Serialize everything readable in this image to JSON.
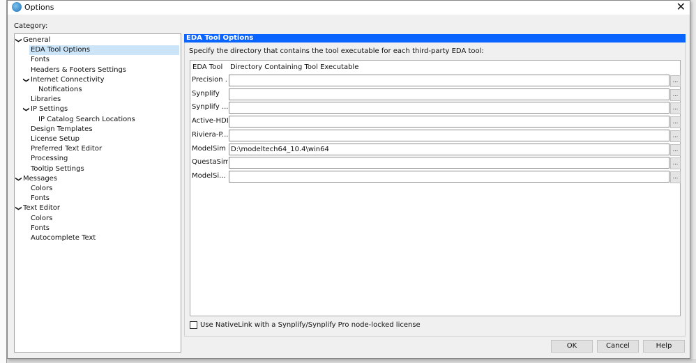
{
  "window": {
    "title": "Options",
    "close": "✕"
  },
  "category_label": "Category:",
  "tree": [
    {
      "label": "General",
      "level": 0,
      "expanded": true
    },
    {
      "label": "EDA Tool Options",
      "level": 1,
      "selected": true
    },
    {
      "label": "Fonts",
      "level": 1
    },
    {
      "label": "Headers & Footers Settings",
      "level": 1
    },
    {
      "label": "Internet Connectivity",
      "level": 1,
      "expanded": true
    },
    {
      "label": "Notifications",
      "level": 2
    },
    {
      "label": "Libraries",
      "level": 1
    },
    {
      "label": "IP Settings",
      "level": 1,
      "expanded": true
    },
    {
      "label": "IP Catalog Search Locations",
      "level": 2
    },
    {
      "label": "Design Templates",
      "level": 1
    },
    {
      "label": "License Setup",
      "level": 1
    },
    {
      "label": "Preferred Text Editor",
      "level": 1
    },
    {
      "label": "Processing",
      "level": 1
    },
    {
      "label": "Tooltip Settings",
      "level": 1
    },
    {
      "label": "Messages",
      "level": 0,
      "expanded": true
    },
    {
      "label": "Colors",
      "level": 1
    },
    {
      "label": "Fonts",
      "level": 1
    },
    {
      "label": "Text Editor",
      "level": 0,
      "expanded": true
    },
    {
      "label": "Colors",
      "level": 1
    },
    {
      "label": "Fonts",
      "level": 1
    },
    {
      "label": "Autocomplete Text",
      "level": 1
    }
  ],
  "panel": {
    "header": "EDA Tool Options",
    "description": "Specify the directory that contains the tool executable for each third-party EDA tool:",
    "columns": [
      "EDA Tool",
      "Directory Containing Tool Executable"
    ],
    "rows": [
      {
        "tool": "Precision ...",
        "dir": ""
      },
      {
        "tool": "Synplify",
        "dir": ""
      },
      {
        "tool": "Synplify ...",
        "dir": ""
      },
      {
        "tool": "Active-HDL",
        "dir": ""
      },
      {
        "tool": "Riviera-P...",
        "dir": ""
      },
      {
        "tool": "ModelSim",
        "dir": "D:\\modeltech64_10.4\\win64"
      },
      {
        "tool": "QuestaSim",
        "dir": ""
      },
      {
        "tool": "ModelSi...",
        "dir": ""
      }
    ],
    "browse_label": "...",
    "nativelink_label": "Use NativeLink with a Synplify/Synplify Pro node-locked license",
    "nativelink_checked": false
  },
  "buttons": {
    "ok": "OK",
    "cancel": "Cancel",
    "help": "Help"
  },
  "colors": {
    "header_bg": "#0a64ff",
    "selection": "#cce4f7"
  }
}
